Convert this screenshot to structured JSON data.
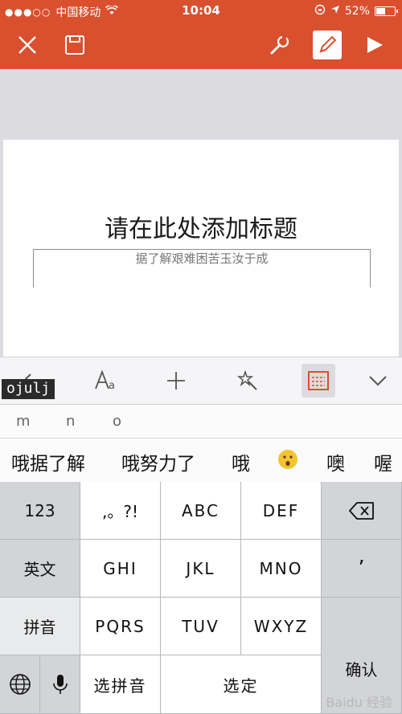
{
  "status_bar": {
    "carrier": "中国移动",
    "time": "10:04",
    "battery": "52%",
    "battery_level": 0.52
  },
  "toolbar": {
    "icons": [
      "close-icon",
      "save-icon",
      "wrench-icon",
      "pen-icon",
      "play-icon"
    ],
    "accent": "#d9502e"
  },
  "slide": {
    "title": "请在此处添加标题",
    "subtitle_text": "据了解艰难困苦玉汝于成"
  },
  "format_bar": {
    "icons": [
      "undo-icon",
      "text-format-icon",
      "insert-icon",
      "magic-wand-icon",
      "layout-icon",
      "chevron-down-icon"
    ],
    "tooltip": "ojulj"
  },
  "pinyin_hints": [
    "m",
    "n",
    "o"
  ],
  "candidates": [
    "哦据了解",
    "哦努力了",
    "哦",
    "😯",
    "噢",
    "喔"
  ],
  "keyboard": {
    "row1": [
      "123",
      ",。?!",
      "ABC",
      "DEF"
    ],
    "row2": [
      "英文",
      "GHI",
      "JKL",
      "MNO",
      "’"
    ],
    "row3": [
      "拼音",
      "PQRS",
      "TUV",
      "WXYZ"
    ],
    "row4": [
      "选拼音",
      "选定"
    ],
    "confirm": "确认",
    "watermark": "Baidu 经验"
  }
}
